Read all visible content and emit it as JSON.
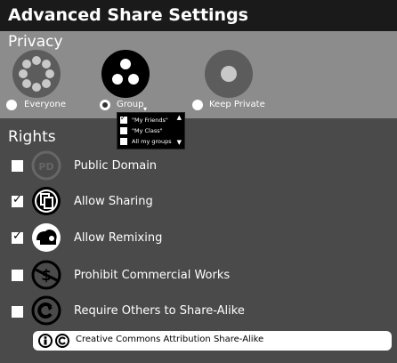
{
  "window": {
    "title": "Advanced Share Settings"
  },
  "privacy": {
    "heading": "Privacy",
    "options": [
      {
        "label": "Everyone",
        "icon": "everyone-icon",
        "selected": false
      },
      {
        "label": "Group",
        "icon": "group-icon",
        "selected": true
      },
      {
        "label": "Keep Private",
        "icon": "private-icon",
        "selected": false
      }
    ],
    "group_dropdown": {
      "arrow": "▾",
      "items": [
        {
          "label": "\"My Friends\"",
          "checked": true
        },
        {
          "label": "\"My Class\"",
          "checked": false
        },
        {
          "label": "All my groups",
          "checked": false
        }
      ],
      "scroll_up": "▲",
      "scroll_down": "▼"
    }
  },
  "rights": {
    "heading": "Rights",
    "items": [
      {
        "label": "Public Domain",
        "checked": false,
        "icon": "public-domain-icon",
        "icon_text": "PD"
      },
      {
        "label": "Allow Sharing",
        "checked": true,
        "icon": "share-icon"
      },
      {
        "label": "Allow Remixing",
        "checked": true,
        "icon": "remix-icon"
      },
      {
        "label": "Prohibit Commercial Works",
        "checked": false,
        "icon": "noncommercial-icon"
      },
      {
        "label": "Require Others to Share-Alike",
        "checked": false,
        "icon": "share-alike-icon"
      }
    ]
  },
  "license": {
    "text": "Creative Commons Attribution Share-Alike"
  },
  "colors": {
    "titlebar": "#1a1a1a",
    "privacy_bg": "#8c8c8c",
    "body_bg": "#4a4a4a"
  }
}
